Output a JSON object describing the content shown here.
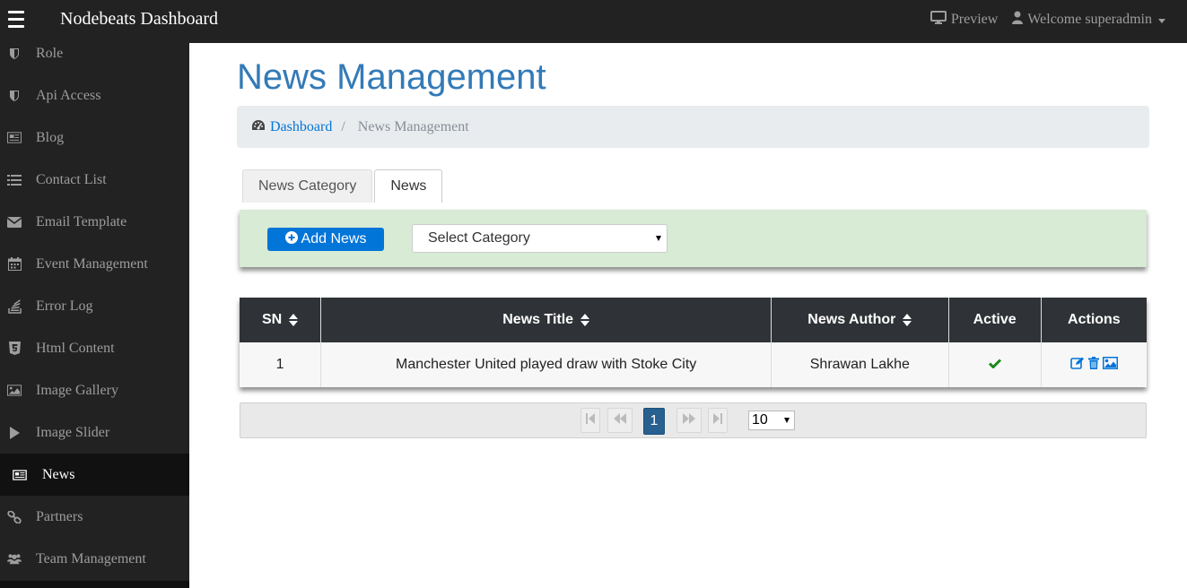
{
  "topbar": {
    "brand": "Nodebeats Dashboard",
    "preview_label": "Preview",
    "welcome_label": "Welcome superadmin"
  },
  "sidebar": {
    "items": [
      {
        "label": "Role",
        "icon": "shield-icon"
      },
      {
        "label": "Api Access",
        "icon": "shield-icon"
      },
      {
        "label": "Blog",
        "icon": "newspaper-icon"
      },
      {
        "label": "Contact List",
        "icon": "list-icon"
      },
      {
        "label": "Email Template",
        "icon": "envelope-icon"
      },
      {
        "label": "Event Management",
        "icon": "calendar-icon"
      },
      {
        "label": "Error Log",
        "icon": "stack-icon"
      },
      {
        "label": "Html Content",
        "icon": "html5-icon"
      },
      {
        "label": "Image Gallery",
        "icon": "image-icon"
      },
      {
        "label": "Image Slider",
        "icon": "play-icon"
      },
      {
        "label": "News",
        "icon": "newspaper-icon",
        "active": true
      },
      {
        "label": "Partners",
        "icon": "link-icon"
      },
      {
        "label": "Team Management",
        "icon": "users-icon"
      }
    ]
  },
  "main": {
    "title": "News Management",
    "breadcrumb": {
      "home": "Dashboard",
      "separator": "/",
      "current": "News Management"
    },
    "tabs": [
      {
        "label": "News Category",
        "active": false
      },
      {
        "label": "News",
        "active": true
      }
    ],
    "filter": {
      "add_label": "Add News",
      "select_value": "Select Category"
    },
    "table": {
      "headers": [
        "SN",
        "News Title",
        "News Author",
        "Active",
        "Actions"
      ],
      "rows": [
        {
          "sn": "1",
          "title": "Manchester United played draw with Stoke City",
          "author": "Shrawan Lakhe",
          "active": true
        }
      ]
    },
    "pager": {
      "current_page": "1",
      "per_page": "10"
    }
  },
  "colors": {
    "topbar_bg": "#222222",
    "accent": "#337ab7",
    "primary_button": "#0275d8",
    "filter_bg": "#d7ebd5",
    "table_header": "#2f3236",
    "check_green": "#1a8a1a"
  }
}
